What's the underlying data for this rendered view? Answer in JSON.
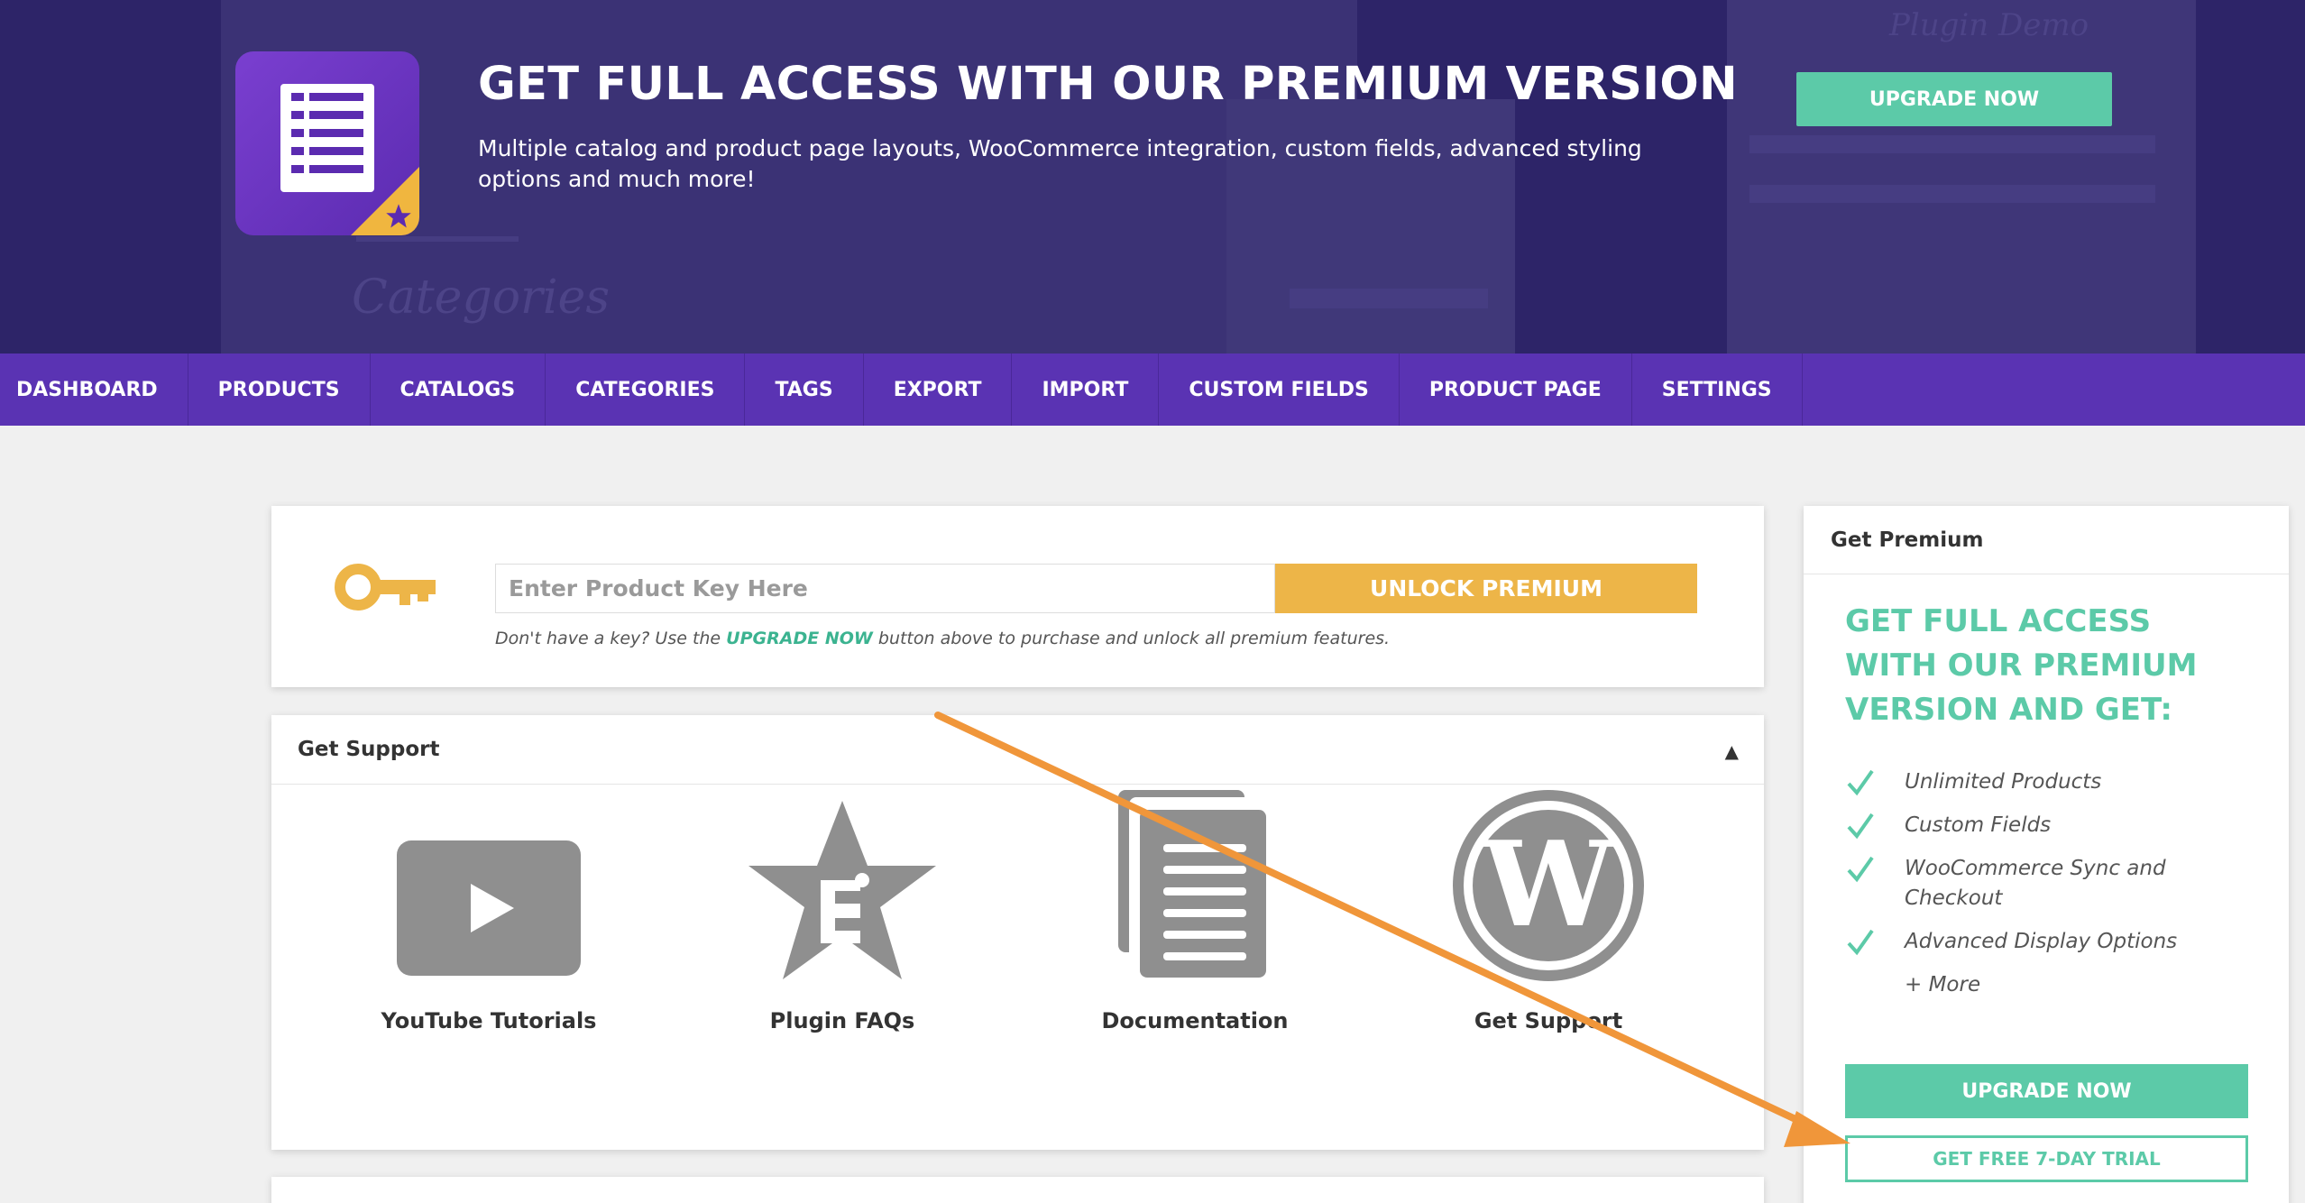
{
  "banner": {
    "title": "GET FULL ACCESS WITH OUR PREMIUM VERSION",
    "subtitle": "Multiple catalog and product page layouts, WooCommerce integration, custom fields, advanced styling options and much more!",
    "upgrade_button": "UPGRADE NOW",
    "logo_icon": "catalog-list-icon"
  },
  "nav": {
    "items": [
      "DASHBOARD",
      "PRODUCTS",
      "CATALOGS",
      "CATEGORIES",
      "TAGS",
      "EXPORT",
      "IMPORT",
      "CUSTOM FIELDS",
      "PRODUCT PAGE",
      "SETTINGS"
    ]
  },
  "license": {
    "placeholder": "Enter Product Key Here",
    "unlock_button": "UNLOCK PREMIUM",
    "note_before": "Don't have a key? Use the ",
    "note_highlight": "UPGRADE NOW",
    "note_after": " button above to purchase and unlock all premium features."
  },
  "support": {
    "title": "Get Support",
    "collapse_symbol": "▲",
    "items": [
      {
        "label": "YouTube Tutorials",
        "icon": "youtube-icon"
      },
      {
        "label": "Plugin FAQs",
        "icon": "faq-star-icon"
      },
      {
        "label": "Documentation",
        "icon": "documentation-icon"
      },
      {
        "label": "Get Support",
        "icon": "wordpress-icon"
      }
    ]
  },
  "premium": {
    "heading": "Get Premium",
    "title": "GET FULL ACCESS WITH OUR PREMIUM VERSION AND GET:",
    "features": [
      "Unlimited Products",
      "Custom Fields",
      "WooCommerce Sync and Checkout",
      "Advanced Display Options"
    ],
    "more": "+ More",
    "upgrade_button": "UPGRADE NOW",
    "trial_button": "GET FREE 7-DAY TRIAL"
  },
  "colors": {
    "banner_bg": "#2d2468",
    "nav_bg": "#5a33b3",
    "accent_green": "#5ccaa8",
    "accent_gold": "#edb548",
    "annotation_arrow": "#f0963a"
  }
}
